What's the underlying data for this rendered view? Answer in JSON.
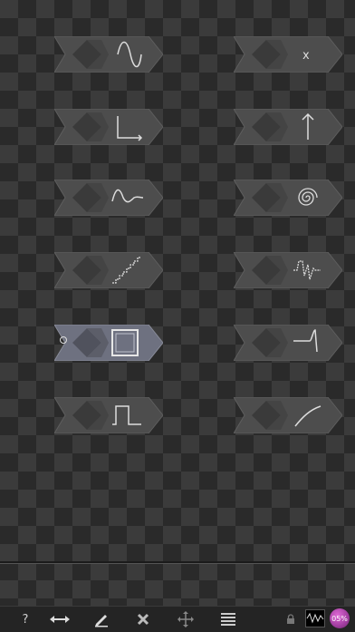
{
  "modules": [
    {
      "icon": "sine-wave-icon",
      "active": false
    },
    {
      "icon": "x-mark-icon",
      "label": "x",
      "active": false
    },
    {
      "icon": "axes-icon",
      "active": false
    },
    {
      "icon": "up-arrow-icon",
      "active": false
    },
    {
      "icon": "decay-wave-icon",
      "active": false
    },
    {
      "icon": "spiral-icon",
      "active": false
    },
    {
      "icon": "staircase-icon",
      "active": false
    },
    {
      "icon": "noise-wave-icon",
      "active": false
    },
    {
      "icon": "square-icon",
      "active": true
    },
    {
      "icon": "peak-icon",
      "active": false
    },
    {
      "icon": "pulse-icon",
      "active": false
    },
    {
      "icon": "curve-icon",
      "active": false
    }
  ],
  "toolbar": {
    "help_label": "?",
    "badge_text": "05%",
    "icons": [
      "help-icon",
      "stretch-icon",
      "pencil-icon",
      "delete-icon",
      "move-icon",
      "list-icon",
      "lock-icon",
      "scope-icon"
    ]
  }
}
